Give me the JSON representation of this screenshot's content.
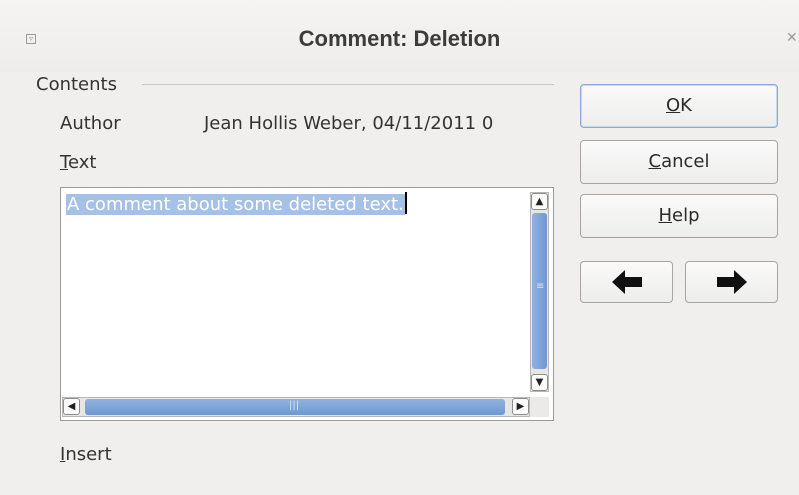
{
  "window": {
    "title": "Comment: Deletion",
    "menu_icon": "window-menu-icon",
    "close_icon": "close-icon"
  },
  "contents": {
    "section_label": "Contents",
    "author_label": "Author",
    "author_value": "Jean Hollis Weber, 04/11/2011 0",
    "text_label_mnemonic": "T",
    "text_label_rest": "ext",
    "text_value": "A comment about some deleted text.",
    "insert_label_mnemonic": "I",
    "insert_label_rest": "nsert"
  },
  "buttons": {
    "ok_mnemonic": "O",
    "ok_rest": "K",
    "cancel_mnemonic": "C",
    "cancel_rest": "ancel",
    "help_mnemonic": "H",
    "help_rest": "elp",
    "prev_icon": "arrow-left-icon",
    "next_icon": "arrow-right-icon"
  },
  "colors": {
    "selection": "#a6c1e8",
    "scrollbar_thumb": "#7ea4d8",
    "background": "#f0efee"
  }
}
